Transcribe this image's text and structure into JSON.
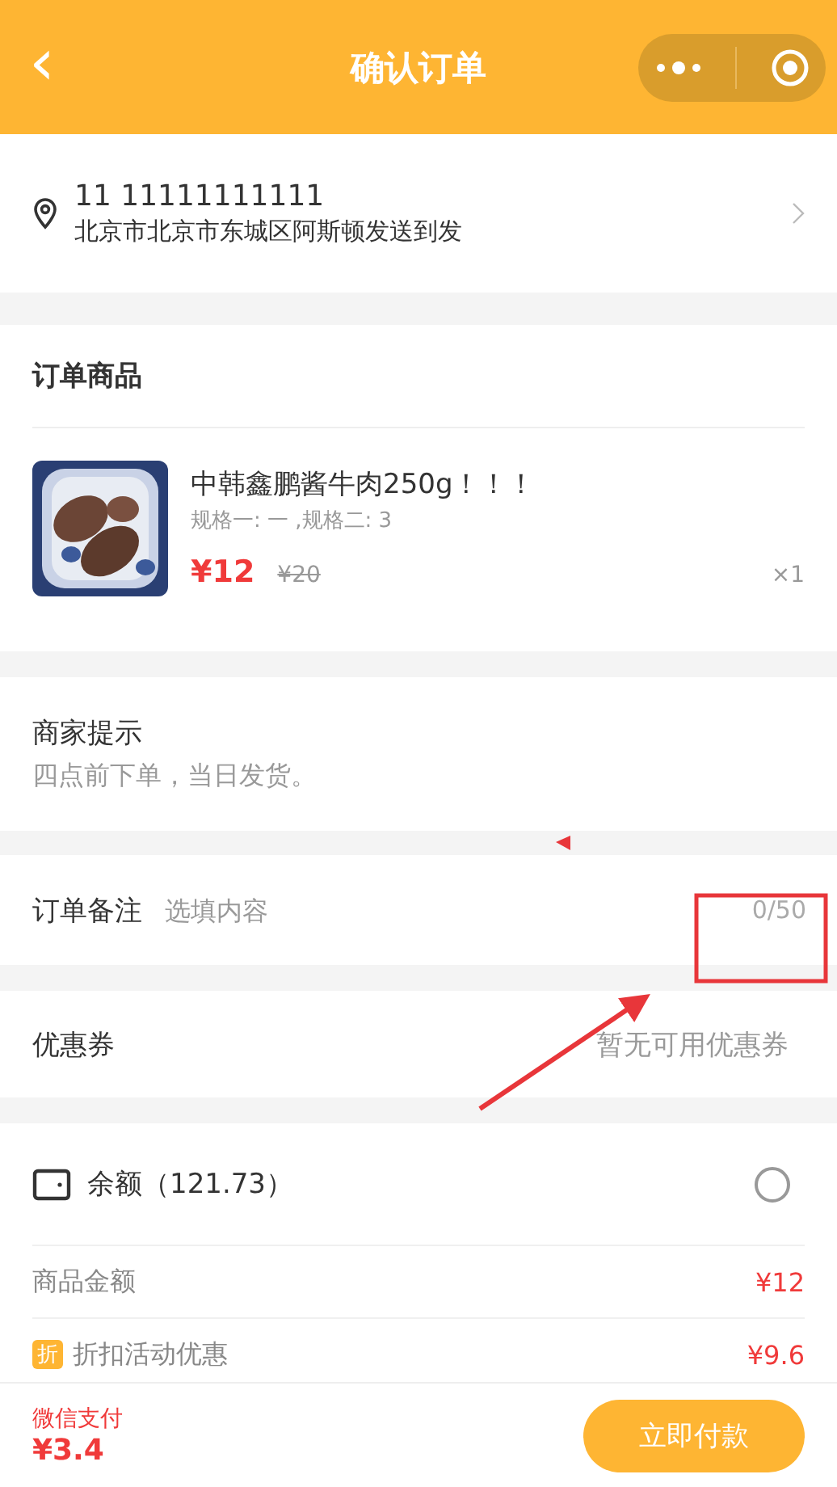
{
  "nav_bar": {
    "back": "‹",
    "title": "确认订单"
  },
  "address": {
    "contact": "11 11111111111",
    "detail": "北京市北京市东城区阿斯顿发送到发"
  },
  "order_items": {
    "title": "订单商品",
    "items": [
      {
        "name": "中韩鑫鹏酱牛肉250g！！！",
        "specs": "规格一: 一 ,规格二: 3",
        "price": "¥12",
        "original_price": "¥20",
        "quantity": "×1"
      }
    ]
  },
  "merchant_tip": {
    "label": "商家提示",
    "text": "四点前下单，当日发货。"
  },
  "order_note": {
    "label": "订单备注",
    "placeholder": "选填内容",
    "counter": "0/50"
  },
  "coupon": {
    "label": "优惠券",
    "value": "暂无可用优惠券"
  },
  "balance": {
    "label": "余额（121.73）",
    "selected": false
  },
  "summary": [
    {
      "kind": "plain",
      "label": "商品金额",
      "amount": "¥12"
    },
    {
      "kind": "discount",
      "badge": "折",
      "label": "折扣活动优惠",
      "amount": "¥9.6"
    }
  ],
  "footer": {
    "method": "微信支付",
    "total": "¥3.4",
    "pay_button": "立即付款"
  },
  "annotations": [
    {
      "kind": "marker"
    },
    {
      "kind": "box"
    },
    {
      "kind": "arrow"
    }
  ]
}
